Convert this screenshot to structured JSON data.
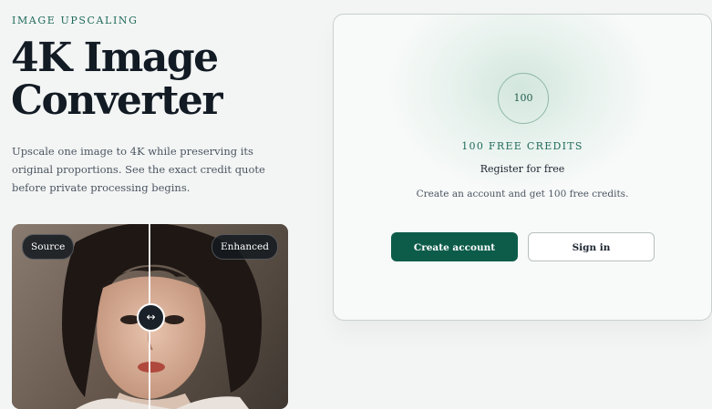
{
  "hero": {
    "eyebrow": "IMAGE UPSCALING",
    "title_line1": "4K Image",
    "title_line2": "Converter",
    "description": "Upscale one image to 4K while preserving its original proportions. See the exact credit quote before private processing begins."
  },
  "compare": {
    "source_label": "Source",
    "enhanced_label": "Enhanced",
    "handle_glyph": "↔",
    "handle_icon": "arrows-horizontal-icon"
  },
  "card": {
    "credits_badge": "100",
    "credits_heading": "100 FREE CREDITS",
    "register_text": "Register for free",
    "note_text": "Create an account and get 100 free credits.",
    "create_account_label": "Create account",
    "sign_in_label": "Sign in"
  },
  "colors": {
    "accent": "#0d5c4a",
    "eyebrow": "#1f6a5a",
    "background": "#f3f5f4"
  }
}
